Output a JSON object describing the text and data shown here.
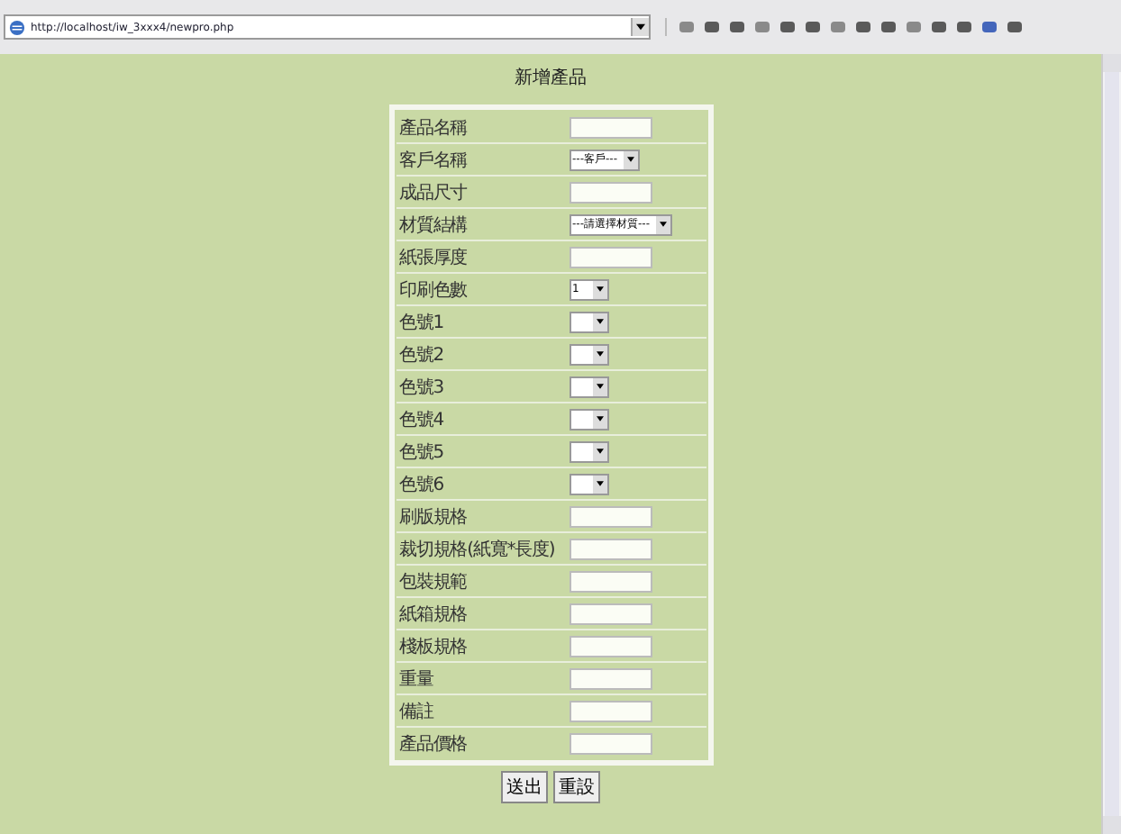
{
  "address_bar": {
    "url": "http://localhost/iw_3xxx4/newpro.php"
  },
  "page": {
    "title": "新增產品"
  },
  "form": {
    "rows": [
      {
        "label": "產品名稱",
        "kind": "text"
      },
      {
        "label": "客戶名稱",
        "kind": "select",
        "value": "---客戶---"
      },
      {
        "label": "成品尺寸",
        "kind": "text"
      },
      {
        "label": "材質結構",
        "kind": "select",
        "value": "---請選擇材質---"
      },
      {
        "label": "紙張厚度",
        "kind": "text"
      },
      {
        "label": "印刷色數",
        "kind": "select",
        "value": "1"
      },
      {
        "label": "色號1",
        "kind": "select"
      },
      {
        "label": "色號2",
        "kind": "select"
      },
      {
        "label": "色號3",
        "kind": "select"
      },
      {
        "label": "色號4",
        "kind": "select"
      },
      {
        "label": "色號5",
        "kind": "select"
      },
      {
        "label": "色號6",
        "kind": "select"
      },
      {
        "label": "刷版規格",
        "kind": "text"
      },
      {
        "label": "裁切規格(紙寬*長度)",
        "kind": "text"
      },
      {
        "label": "包裝規範",
        "kind": "text"
      },
      {
        "label": "紙箱規格",
        "kind": "text"
      },
      {
        "label": "棧板規格",
        "kind": "text"
      },
      {
        "label": "重量",
        "kind": "text"
      },
      {
        "label": "備註",
        "kind": "text"
      },
      {
        "label": "產品價格",
        "kind": "text"
      }
    ]
  },
  "buttons": [
    "送出",
    "重設"
  ]
}
